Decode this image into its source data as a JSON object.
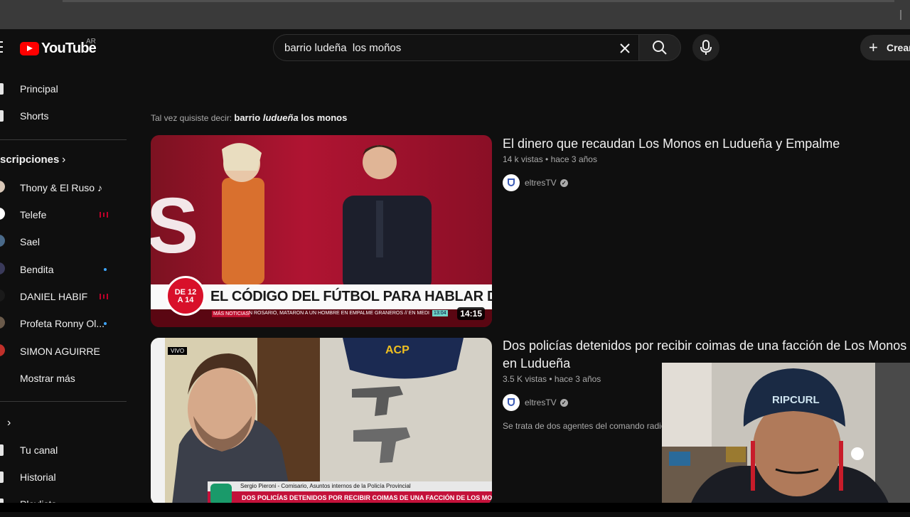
{
  "header": {
    "logo_text": "YouTube",
    "country_code": "AR",
    "search_value": "barrio ludeña  los moños",
    "create_label": "Crear"
  },
  "sidebar": {
    "main": [
      {
        "label": "Principal"
      },
      {
        "label": "Shorts"
      }
    ],
    "subscriptions_heading": "scripciones",
    "subscriptions": [
      {
        "label": "Thony & El Ruso ♪",
        "status": "none",
        "avatar_color": "#d9c8b8"
      },
      {
        "label": "Telefe",
        "status": "live",
        "avatar_color": "#ffffff"
      },
      {
        "label": "Sael",
        "status": "none",
        "avatar_color": "#4a6a8a"
      },
      {
        "label": "Bendita",
        "status": "new",
        "avatar_color": "#3a3a5a"
      },
      {
        "label": "DANIEL HABIF",
        "status": "live",
        "avatar_color": "#1a1a1a"
      },
      {
        "label": "Profeta Ronny Ol...",
        "status": "new",
        "avatar_color": "#6a5a4a"
      },
      {
        "label": "SIMON AGUIRRE",
        "status": "none",
        "avatar_color": "#c0302a"
      }
    ],
    "show_more": "Mostrar más",
    "you": [
      {
        "label": "Tu canal"
      },
      {
        "label": "Historial"
      },
      {
        "label": "Playlists"
      }
    ]
  },
  "did_you_mean": {
    "prefix": "Tal vez quisiste decir:",
    "word1": "barrio",
    "word2": "ludueña",
    "word3": "los monos"
  },
  "results": [
    {
      "title": "El dinero que recaudan Los Monos en Ludueña y Empalme",
      "views": "14 k vistas",
      "age": "hace 3 años",
      "channel": "eltresTV",
      "duration": "14:15",
      "thumb_badge": "DE 12 A 14",
      "thumb_headline": "EL CÓDIGO DEL FÚTBOL PARA HABLAR DE TIROS",
      "thumb_ticker_label": "MÁS NOTICIAS",
      "thumb_ticker": "N ROSARIO, MATARON A UN HOMBRE EN EMPALME GRANEROS // EN MEDI",
      "thumb_clock": "13:04"
    },
    {
      "title": "Dos policías detenidos por recibir coimas de una facción de Los Monos en Ludueña",
      "views": "3.5 K vistas",
      "age": "hace 3 años",
      "channel": "eltresTV",
      "snippet": "Se trata de dos agentes del comando radioeléctrico",
      "thumb_live": "VIVO",
      "thumb_caption": "Sergio Pieroni - Comisario, Asuntos internos de la Policía Provincial",
      "thumb_headline": "DOS POLICÍAS DETENIDOS POR RECIBIR COIMAS DE UNA FACCIÓN DE LOS MONOS",
      "thumb_cap_text": "ACP"
    }
  ],
  "webcam": {
    "cap_text": "RIPCURL"
  }
}
